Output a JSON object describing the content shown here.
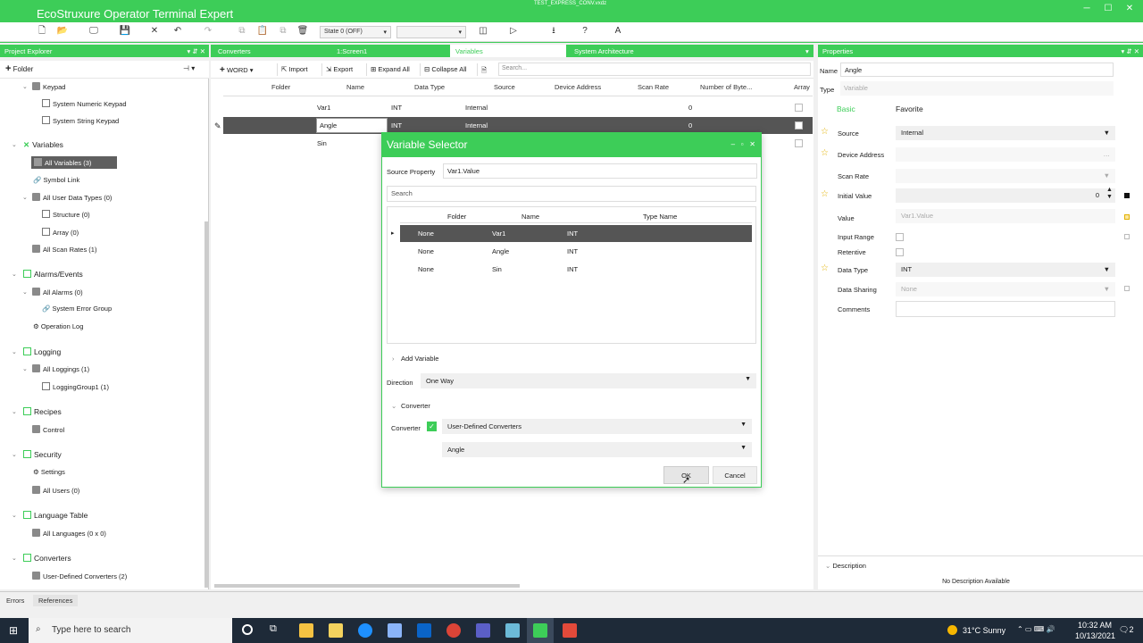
{
  "window": {
    "app_title": "EcoStruxure Operator Terminal Expert",
    "file_title": "TEST_EXPRESS_CONV.vxdz"
  },
  "toolbar": {
    "state_dropdown": "State 0 (OFF)"
  },
  "project_explorer": {
    "title": "Project Explorer",
    "folder_button": "Folder",
    "tree": {
      "keypad": "Keypad",
      "numeric_keypad": "System Numeric Keypad",
      "string_keypad": "System String Keypad",
      "variables": "Variables",
      "all_variables": "All Variables (3)",
      "symbol_link": "Symbol Link",
      "user_types": "All User Data Types (0)",
      "structure": "Structure (0)",
      "array": "Array (0)",
      "scan_rates": "All Scan Rates (1)",
      "alarms": "Alarms/Events",
      "all_alarms": "All Alarms (0)",
      "sys_error": "System Error Group",
      "op_log": "Operation Log",
      "logging": "Logging",
      "all_loggings": "All Loggings (1)",
      "logging_group": "LoggingGroup1 (1)",
      "recipes": "Recipes",
      "control": "Control",
      "security": "Security",
      "settings": "Settings",
      "all_users": "All Users (0)",
      "language": "Language Table",
      "all_languages": "All Languages (0 x 0)",
      "converters": "Converters",
      "user_converters": "User-Defined Converters (2)"
    }
  },
  "tabs": [
    "Converters",
    "1:Screen1",
    "Variables",
    "System Architecture"
  ],
  "var_toolbar": {
    "word": "WORD",
    "import": "Import",
    "export": "Export",
    "expand_all": "Expand All",
    "collapse_all": "Collapse All",
    "search_placeholder": "Search..."
  },
  "var_grid": {
    "headers": [
      "Folder",
      "Name",
      "Data Type",
      "Source",
      "Device Address",
      "Scan Rate",
      "Number of Byte...",
      "Array"
    ],
    "rows": [
      {
        "name": "Var1",
        "type": "INT",
        "source": "Internal",
        "bytes": "0"
      },
      {
        "name": "Angle",
        "type": "INT",
        "source": "Internal",
        "bytes": "0"
      },
      {
        "name": "Sin",
        "type": "",
        "source": "",
        "bytes": ""
      }
    ]
  },
  "dialog": {
    "title": "Variable Selector",
    "source_property_label": "Source Property",
    "source_property_value": "Var1.Value",
    "search_placeholder": "Search",
    "grid_headers": [
      "Folder",
      "Name",
      "Type Name"
    ],
    "rows": [
      {
        "folder": "None",
        "name": "Var1",
        "type": "INT"
      },
      {
        "folder": "None",
        "name": "Angle",
        "type": "INT"
      },
      {
        "folder": "None",
        "name": "Sin",
        "type": "INT"
      }
    ],
    "add_variable": "Add Variable",
    "direction_label": "Direction",
    "direction_value": "One Way",
    "converter_section": "Converter",
    "converter_label": "Converter",
    "converter_type": "User-Defined Converters",
    "converter_value": "Angle",
    "ok": "OK",
    "cancel": "Cancel"
  },
  "properties": {
    "title": "Properties",
    "name_label": "Name",
    "name_value": "Angle",
    "type_label": "Type",
    "type_value": "Variable",
    "tab_basic": "Basic",
    "tab_favorite": "Favorite",
    "source_label": "Source",
    "source_value": "Internal",
    "device_address_label": "Device Address",
    "scan_rate_label": "Scan Rate",
    "initial_value_label": "Initial Value",
    "initial_value": "0",
    "value_label": "Value",
    "value_value": "Var1.Value",
    "input_range_label": "Input Range",
    "retentive_label": "Retentive",
    "data_type_label": "Data Type",
    "data_type_value": "INT",
    "data_sharing_label": "Data Sharing",
    "data_sharing_value": "None",
    "comments_label": "Comments",
    "description_label": "Description",
    "description_value": "No Description Available"
  },
  "statusbar": {
    "errors": "Errors",
    "references": "References"
  },
  "taskbar": {
    "search": "Type here to search",
    "weather": "31°C  Sunny",
    "time": "10:32 AM",
    "date": "10/13/2021",
    "notif": "2"
  },
  "colors": {
    "accent": "#3dcd58",
    "selected_row": "#555555",
    "taskbar": "#1e2a38"
  }
}
